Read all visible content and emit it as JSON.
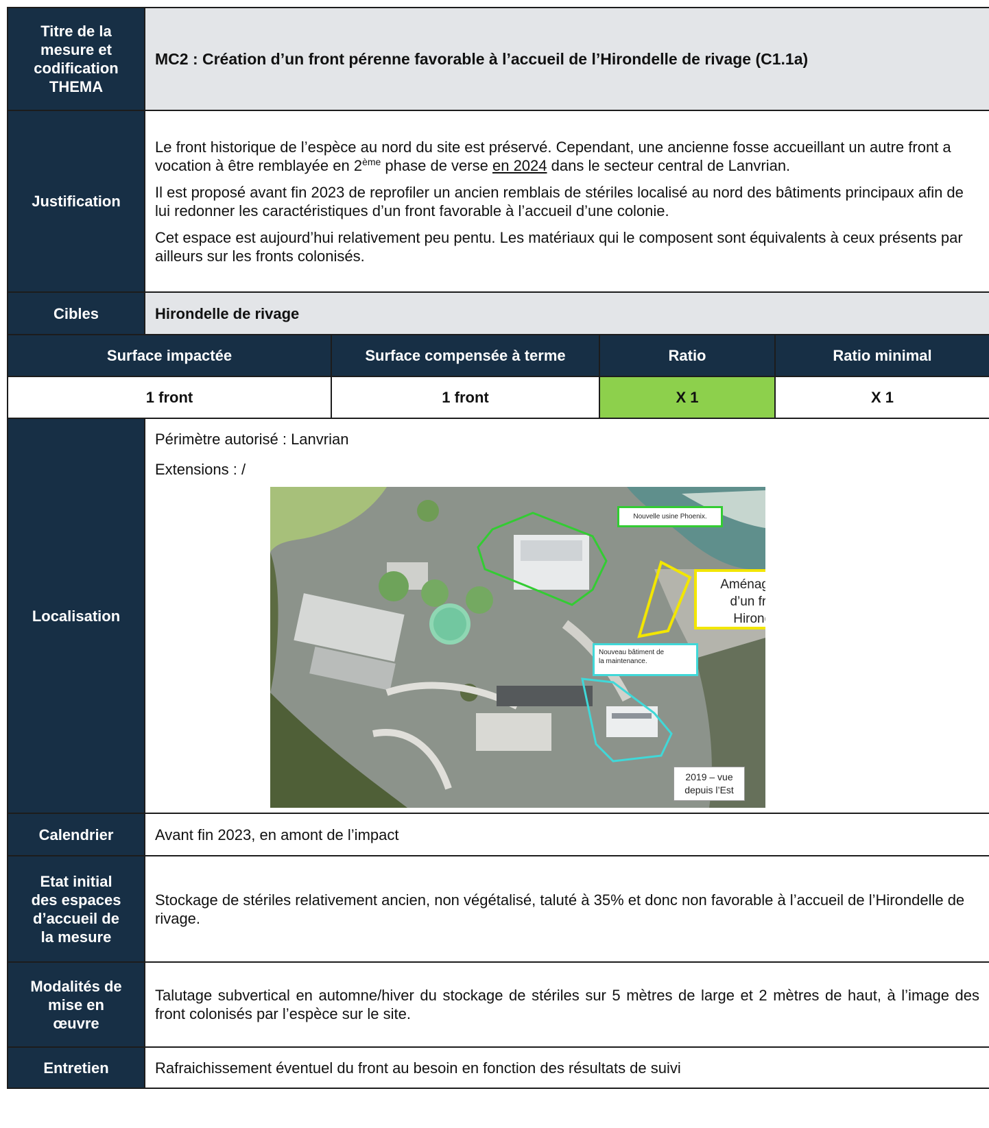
{
  "title_label": [
    "Titre de la",
    "mesure et",
    "codification",
    "THEMA"
  ],
  "title_value": "MC2 : Création d’un front pérenne favorable à l’accueil de l’Hirondelle de rivage (C1.1a)",
  "justification": {
    "label": "Justification",
    "p1_a": "Le front historique de l’espèce au nord du site est préservé. Cependant, une ancienne fosse accueillant un autre front a vocation à être remblayée en 2",
    "p1_sup": "ème",
    "p1_b": " phase de verse ",
    "p1_u": "en 2024",
    "p1_c": " dans le secteur central de Lanvrian.",
    "p2": "Il est proposé avant fin 2023 de reprofiler un ancien remblais de stériles localisé au nord des bâtiments principaux afin de lui redonner les caractéristiques d’un front favorable à l’accueil d’une colonie.",
    "p3": "Cet espace est aujourd’hui relativement peu pentu. Les matériaux qui le composent sont équivalents à ceux présents par ailleurs sur les fronts colonisés."
  },
  "cibles": {
    "label": "Cibles",
    "value": "Hirondelle de rivage"
  },
  "ratio_table": {
    "headers": [
      "Surface impactée",
      "Surface compensée à terme",
      "Ratio",
      "Ratio minimal"
    ],
    "values": [
      "1 front",
      "1 front",
      "X 1",
      "X 1"
    ],
    "ratio_color": "#8dd04c"
  },
  "localisation": {
    "label": "Localisation",
    "perimetre": "Périmètre autorisé : Lanvrian",
    "extensions": "Extensions : /",
    "photo_labels": {
      "usine": "Nouvelle usine Phoenix.",
      "amenagement": [
        "Aménagement",
        "d’un front à",
        "Hirondelle"
      ],
      "maintenance": [
        "Nouveau bâtiment de",
        "la maintenance."
      ],
      "vue": [
        "2019 – vue",
        "depuis l’Est"
      ]
    },
    "outline_colors": {
      "usine": "#33cc33",
      "front": "#f2e600",
      "maintenance": "#40d8d8"
    }
  },
  "calendrier": {
    "label": "Calendrier",
    "value": "Avant fin 2023, en amont de l’impact"
  },
  "etat_initial": {
    "label": [
      "Etat initial",
      "des espaces",
      "d’accueil de",
      "la mesure"
    ],
    "value": "Stockage de stériles relativement ancien, non végétalisé, taluté à 35% et donc non favorable à l’accueil de l’Hirondelle de rivage."
  },
  "modalites": {
    "label": [
      "Modalités de",
      "mise en",
      "œuvre"
    ],
    "value": "Talutage subvertical en automne/hiver du stockage de stériles sur 5 mètres de large et 2 mètres de haut, à l’image des front colonisés par l’espèce sur le site."
  },
  "entretien": {
    "label": "Entretien",
    "value": "Rafraichissement éventuel du front au besoin en fonction des résultats de suivi"
  }
}
